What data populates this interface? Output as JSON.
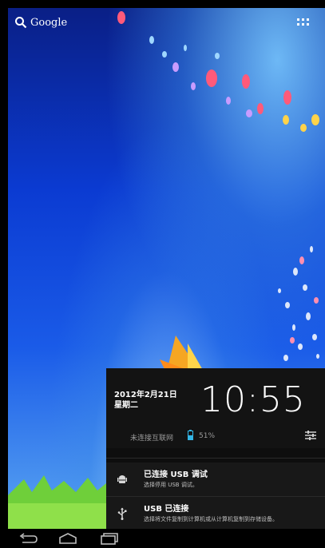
{
  "home": {
    "search_label": "Google",
    "search_icon": "search-icon",
    "apps_icon": "all-apps-grid-icon"
  },
  "notification_panel": {
    "date": "2012年2月21日",
    "weekday": "星期二",
    "time": "10:55",
    "network_status": "未连接互联网",
    "battery_percent": "51%",
    "battery_level": 0.51,
    "settings_icon": "quick-settings-icon",
    "notifications": [
      {
        "icon": "android-debug-icon",
        "title": "已连接 USB 调试",
        "subtitle": "选择停用 USB 调试。"
      },
      {
        "icon": "usb-icon",
        "title": "USB 已连接",
        "subtitle": "选择将文件复制到计算机或从计算机复制到存储设备。"
      }
    ]
  },
  "navigation_bar": {
    "buttons": [
      "back-icon",
      "home-icon",
      "recent-apps-icon"
    ]
  },
  "colors": {
    "panel_background": "#0e0e0e",
    "battery_accent": "#33b5e5",
    "wallpaper_blue": "#0b3bd2"
  }
}
